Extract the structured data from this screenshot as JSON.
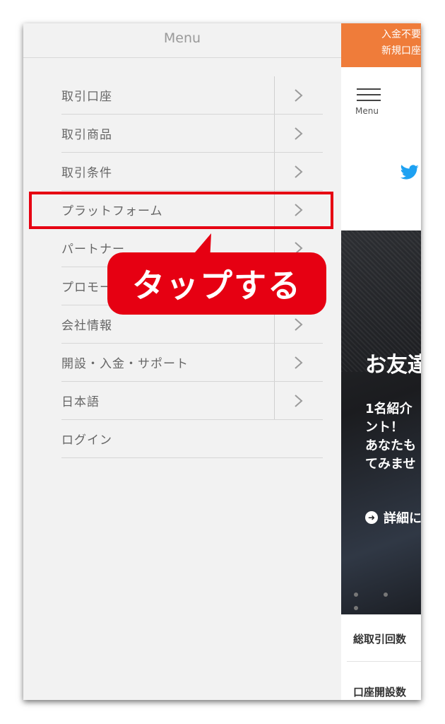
{
  "drawer": {
    "title": "Menu",
    "items": [
      {
        "label": "取引口座",
        "has_chevron": true
      },
      {
        "label": "取引商品",
        "has_chevron": true
      },
      {
        "label": "取引条件",
        "has_chevron": true
      },
      {
        "label": "プラットフォーム",
        "has_chevron": true
      },
      {
        "label": "パートナー",
        "has_chevron": true
      },
      {
        "label": "プロモー",
        "has_chevron": true
      },
      {
        "label": "会社情報",
        "has_chevron": true
      },
      {
        "label": "開設・入金・サポート",
        "has_chevron": true
      },
      {
        "label": "日本語",
        "has_chevron": true
      },
      {
        "label": "ログイン",
        "has_chevron": false
      }
    ]
  },
  "page": {
    "banner_line1": "入金不要",
    "banner_line2": "新規口座",
    "menu_label": "Menu",
    "hero_title": "お友達",
    "hero_text_1": "1名紹介",
    "hero_text_2": "ント！",
    "hero_text_3": "あなたも",
    "hero_text_4": "てみませ",
    "hero_link": "詳細に",
    "stat_1": "総取引回数",
    "stat_2": "口座開設数"
  },
  "annotation": {
    "callout_text": "タップする",
    "highlight_target": "プラットフォーム"
  },
  "colors": {
    "accent_red": "#e60012",
    "banner_orange": "#ef7c3a",
    "twitter_blue": "#1da1f2",
    "drawer_bg": "#f2f2f2"
  },
  "icons": {
    "chevron": "chevron-right-icon",
    "menu": "hamburger-menu-icon",
    "social": "twitter-icon",
    "link": "arrow-circle-right-icon"
  }
}
